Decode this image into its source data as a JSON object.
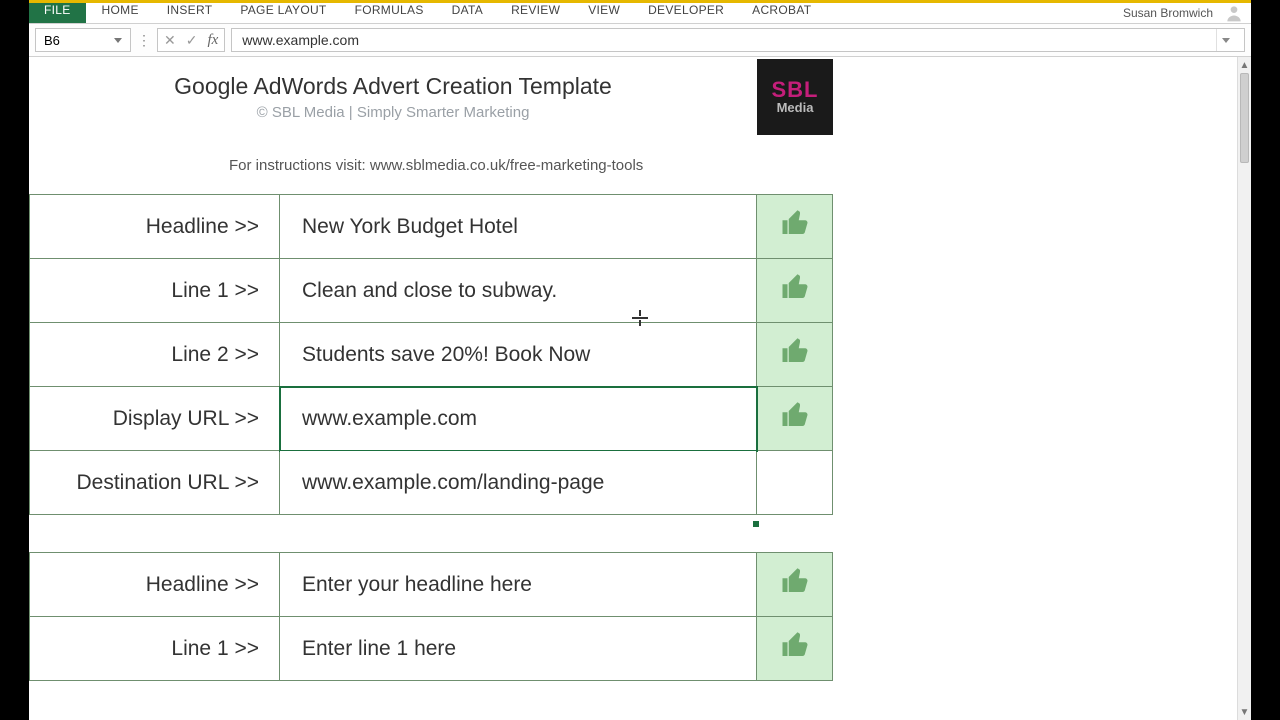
{
  "ribbon": {
    "file": "FILE",
    "tabs": [
      "HOME",
      "INSERT",
      "PAGE LAYOUT",
      "FORMULAS",
      "DATA",
      "REVIEW",
      "VIEW",
      "DEVELOPER",
      "ACROBAT"
    ],
    "user": "Susan Bromwich"
  },
  "formula_bar": {
    "cell_ref": "B6",
    "fx_label": "fx",
    "value": "www.example.com"
  },
  "doc": {
    "title": "Google AdWords Advert Creation Template",
    "subtitle": "© SBL Media | Simply Smarter Marketing",
    "instructions": "For instructions visit: www.sblmedia.co.uk/free-marketing-tools",
    "logo_line1": "SBL",
    "logo_line2": "Media"
  },
  "ad1": {
    "rows": [
      {
        "label": "Headline >>",
        "value": "New York Budget Hotel",
        "thumb": true
      },
      {
        "label": "Line 1 >>",
        "value": "Clean and close to subway.",
        "thumb": true
      },
      {
        "label": "Line 2 >>",
        "value": "Students save 20%! Book Now",
        "thumb": true
      },
      {
        "label": "Display URL >>",
        "value": "www.example.com",
        "thumb": true,
        "selected": true
      },
      {
        "label": "Destination URL >>",
        "value": "www.example.com/landing-page",
        "thumb": false
      }
    ]
  },
  "ad2": {
    "rows": [
      {
        "label": "Headline >>",
        "value": "Enter your headline here",
        "thumb": true
      },
      {
        "label": "Line 1 >>",
        "value": "Enter line 1 here",
        "thumb": true
      }
    ]
  }
}
